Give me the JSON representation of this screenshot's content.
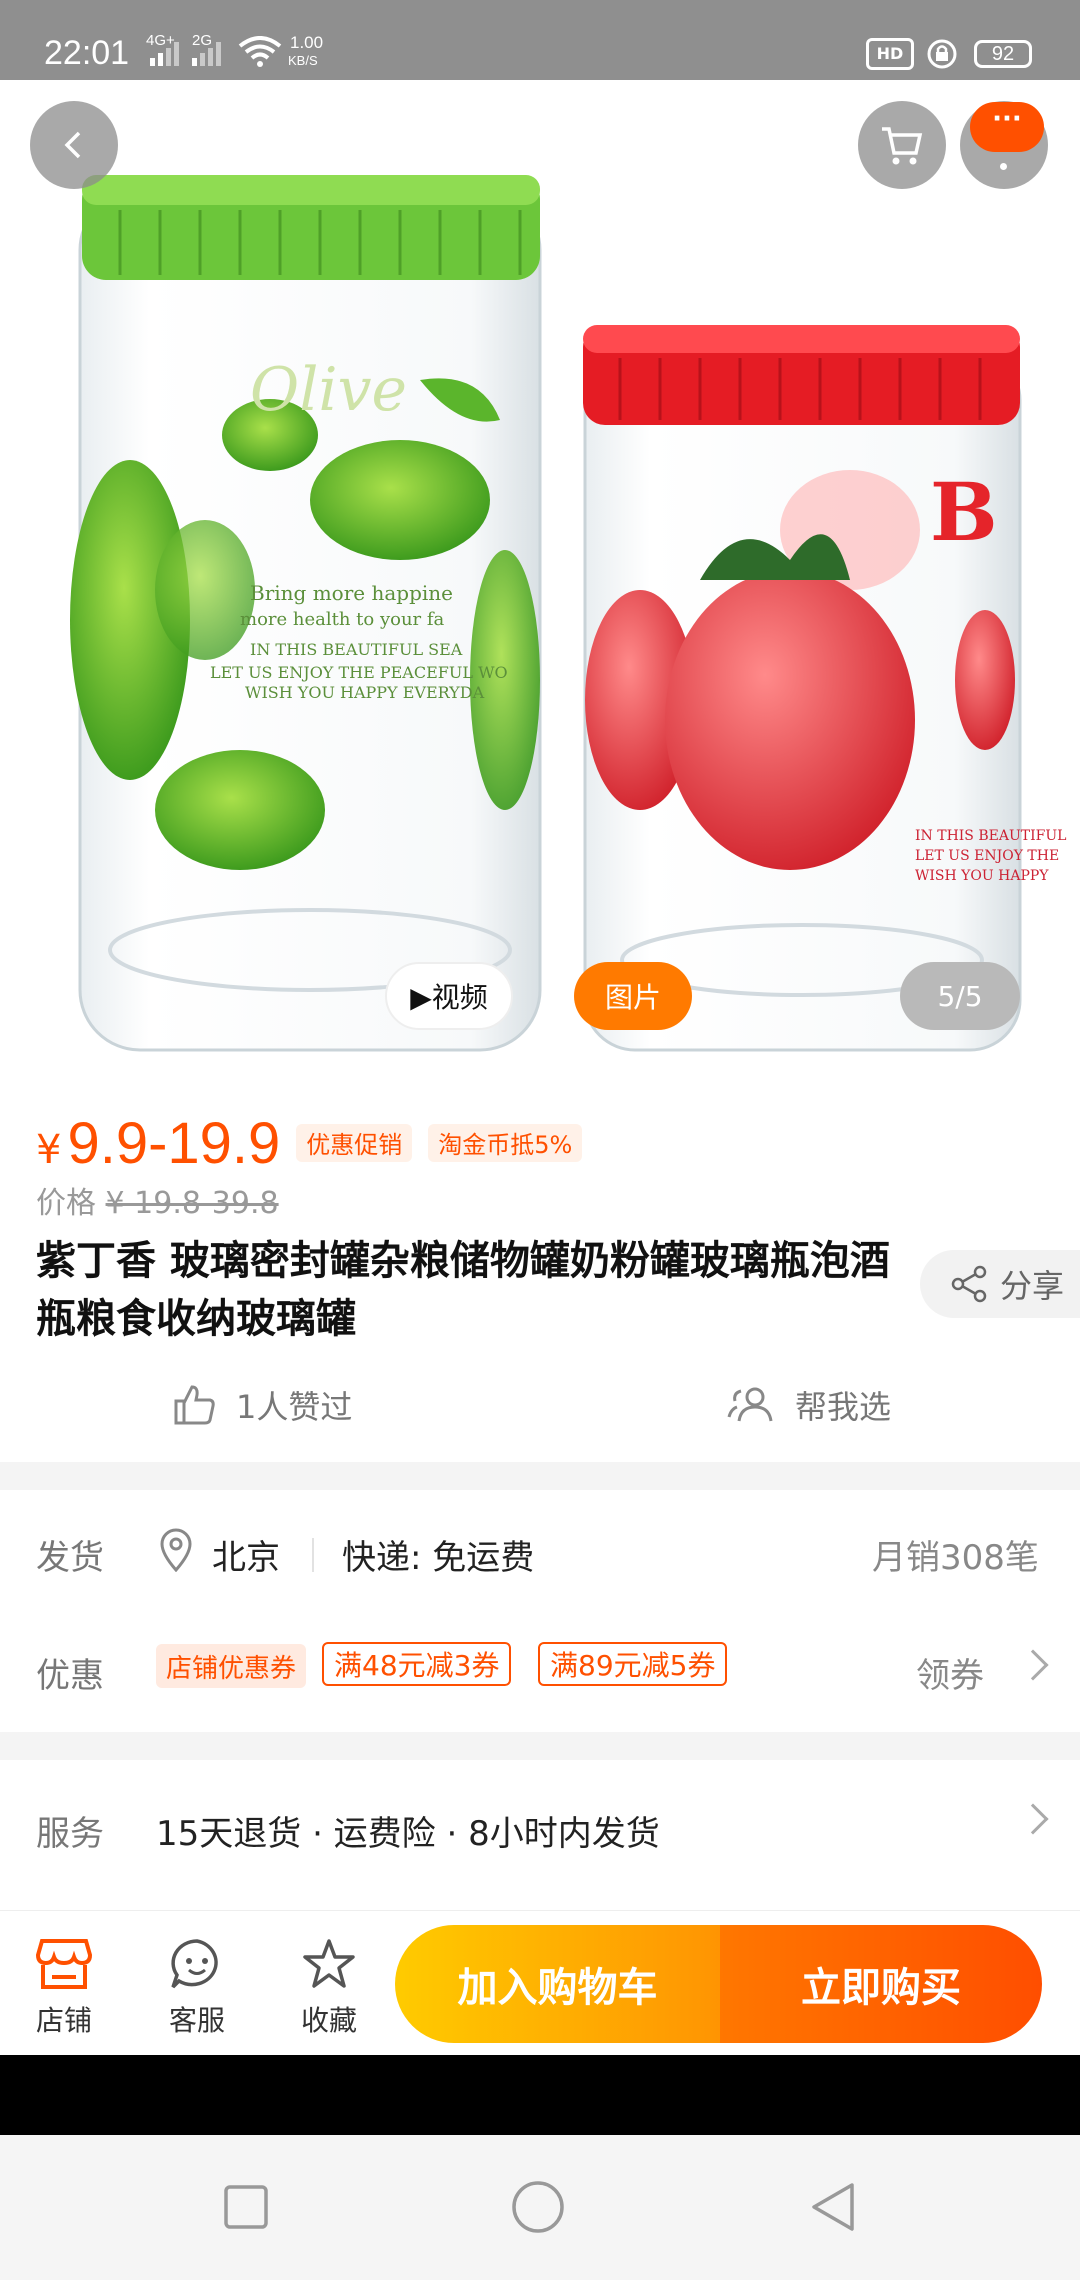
{
  "status_bar": {
    "time": "22:01",
    "network1": "4G+",
    "network2": "2G",
    "speed_value": "1.00",
    "speed_unit": "KB/S",
    "battery": "92"
  },
  "gallery": {
    "video_label": "▶视频",
    "image_label": "图片",
    "counter": "5/5"
  },
  "price": {
    "currency": "¥",
    "range": "9.9-19.9",
    "promo_tag": "优惠促销",
    "coin_tag": "淘金币抵5%",
    "original_label": "价格",
    "original_value": "¥ 19.8-39.8"
  },
  "product": {
    "title": "紫丁香 玻璃密封罐杂粮储物罐奶粉罐玻璃瓶泡酒瓶粮食收纳玻璃罐",
    "share_label": "分享",
    "likes_label": "1人赞过",
    "help_choose_label": "帮我选"
  },
  "shipping": {
    "label": "发货",
    "location": "北京",
    "express": "快递: 免运费",
    "monthly_sales": "月销308笔"
  },
  "discount": {
    "label": "优惠",
    "store_coupon": "店铺优惠券",
    "coupons": [
      "满48元减3券",
      "满89元减5券"
    ],
    "get_label": "领券"
  },
  "service": {
    "label": "服务",
    "text": "15天退货 · 运费险 · 8小时内发货"
  },
  "bottom_bar": {
    "shop": "店铺",
    "service": "客服",
    "favorite": "收藏",
    "add_cart": "加入购物车",
    "buy_now": "立即购买"
  },
  "colors": {
    "accent": "#ff5000",
    "cart_gradient_start": "#ffcb00",
    "buy_gradient_end": "#ff4e00"
  }
}
